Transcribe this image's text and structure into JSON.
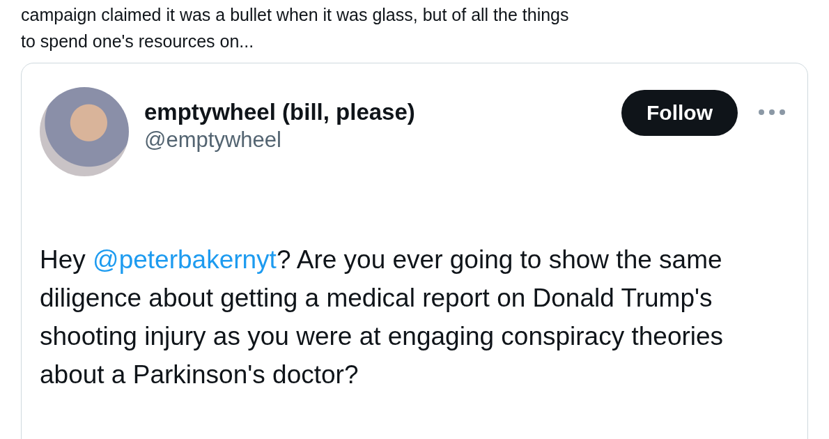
{
  "post_text": [
    "campaign claimed it was a bullet when it was glass, but of all the things",
    "to spend one's resources on..."
  ],
  "quoted_post": {
    "author": {
      "name": "emptywheel (bill, please)",
      "handle": "@emptywheel"
    },
    "follow_button": "Follow",
    "body": [
      {
        "kind": "text",
        "text": "Hey "
      },
      {
        "kind": "mention",
        "text": "@peterbakernyt"
      },
      {
        "kind": "text",
        "text": "? Are you ever going to show the same diligence about getting a medical report on Donald Trump's shooting injury as you were at engaging conspiracy theories about a Parkinson's doctor?"
      }
    ]
  }
}
